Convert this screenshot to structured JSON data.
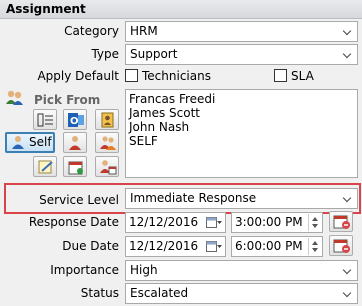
{
  "section": {
    "title": "Assignment"
  },
  "category": {
    "label": "Category",
    "value": "HRM"
  },
  "type": {
    "label": "Type",
    "value": "Support"
  },
  "apply_default": {
    "label": "Apply Default",
    "technicians_label": "Technicians",
    "sla_label": "SLA"
  },
  "pick_from": {
    "label": "Pick From",
    "self_label": "Self",
    "assignees": [
      "Francas Freedi",
      "James Scott",
      "John Nash",
      "SELF"
    ]
  },
  "service_level": {
    "label": "Service Level",
    "value": "Immediate Response"
  },
  "response_date": {
    "label": "Response Date",
    "date": "12/12/2016",
    "time": "3:00:00 PM"
  },
  "due_date": {
    "label": "Due Date",
    "date": "12/12/2016",
    "time": "6:00:00 PM"
  },
  "importance": {
    "label": "Importance",
    "value": "High"
  },
  "status": {
    "label": "Status",
    "value": "Escalated"
  },
  "colors": {
    "highlight_border": "#d9434a",
    "self_button_border": "#3c7fb1"
  }
}
